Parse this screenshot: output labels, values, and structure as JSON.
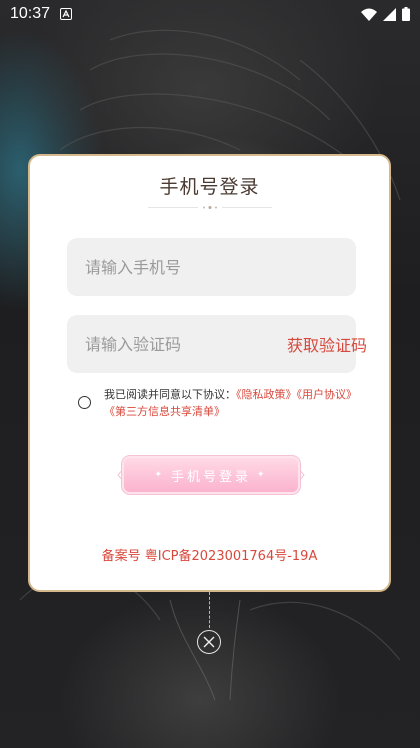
{
  "status_bar": {
    "time": "10:37",
    "icons": [
      "notification-a-icon",
      "wifi-icon",
      "signal-icon",
      "battery-icon"
    ]
  },
  "modal": {
    "title": "手机号登录",
    "phone_placeholder": "请输入手机号",
    "code_placeholder": "请输入验证码",
    "get_code_label": "获取验证码",
    "agreement": {
      "prefix": "我已阅读并同意以下协议：",
      "links": [
        "《隐私政策》",
        "《用户协议》",
        "《第三方信息共享清单》"
      ],
      "checked": false
    },
    "login_label": "手机号登录",
    "icp": "备案号 粤ICP备2023001764号-19A"
  },
  "colors": {
    "accent": "#d8483c",
    "border": "#d5b88b",
    "button_pink": "#fbb3cd"
  }
}
